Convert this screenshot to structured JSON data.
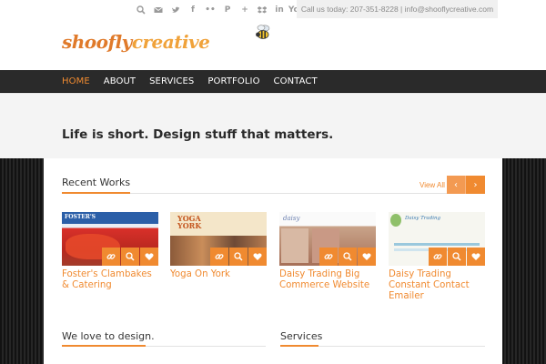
{
  "header": {
    "call_text": "Call us today: 207-351-8228 | info@shooflycreative.com",
    "logo_part1": "shoofly",
    "logo_part2": "creative",
    "social_icons": [
      "search-icon",
      "mail-icon",
      "twitter-icon",
      "facebook-icon",
      "flickr-icon",
      "pinterest-icon",
      "google-plus-icon",
      "dropbox-icon",
      "linkedin-icon",
      "youtube-icon"
    ],
    "social_glyphs": {
      "facebook": "f",
      "flickr": "••",
      "pinterest": "P",
      "google_plus": "+",
      "linkedin": "in",
      "youtube": "You"
    }
  },
  "nav": {
    "items": [
      {
        "label": "HOME",
        "active": true
      },
      {
        "label": "ABOUT",
        "active": false
      },
      {
        "label": "SERVICES",
        "active": false
      },
      {
        "label": "PORTFOLIO",
        "active": false
      },
      {
        "label": "CONTACT",
        "active": false
      }
    ]
  },
  "tagline": "Life is short. Design stuff that matters.",
  "recent_works": {
    "title": "Recent Works",
    "view_all": "View All",
    "prev_arrow": "‹",
    "next_arrow": "›",
    "items": [
      {
        "title_line1": "Foster's Clambakes",
        "title_line2": "& Catering",
        "thumb_text": "FOSTER'S"
      },
      {
        "title_line1": "Yoga On York",
        "title_line2": "",
        "thumb_text": "YOGA YORK"
      },
      {
        "title_line1": "Daisy Trading Big",
        "title_line2": "Commerce Website",
        "thumb_text": "daisy"
      },
      {
        "title_line1": "Daisy Trading",
        "title_line2": "Constant Contact Emailer",
        "thumb_text": "Daisy Trading"
      }
    ]
  },
  "sections": {
    "love": "We love to design.",
    "services": "Services"
  },
  "colors": {
    "accent": "#f08a30",
    "nav_bg": "#2a2a2a",
    "tagline_bg": "#f4f4f4"
  }
}
